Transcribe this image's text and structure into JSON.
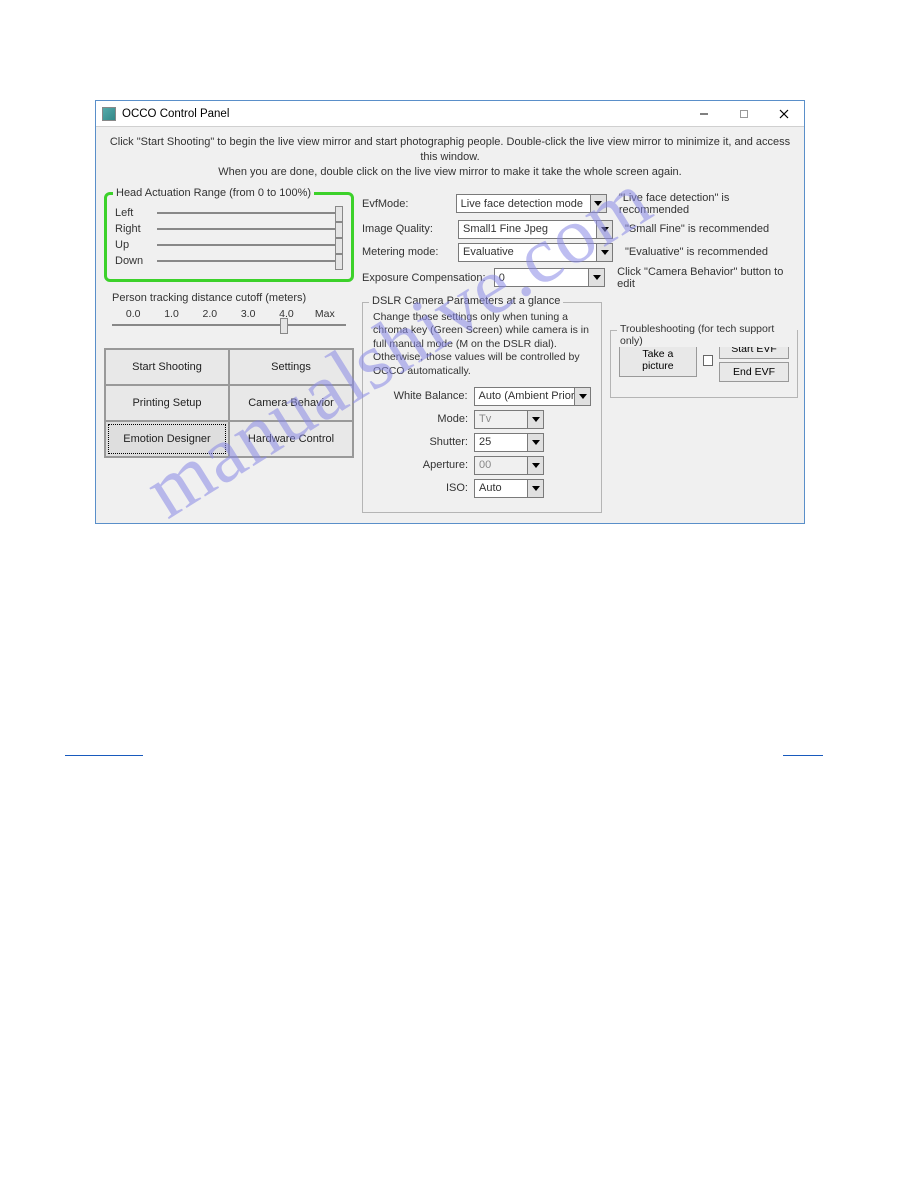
{
  "window": {
    "title": "OCCO Control Panel",
    "instructions_line1": "Click \"Start Shooting\" to begin the live view mirror and start photographig people. Double-click the live view mirror to minimize it, and access this window.",
    "instructions_line2": "When you are done, double click on the live view mirror to make it take the whole screen again."
  },
  "head_range": {
    "legend": "Head Actuation Range (from 0 to 100%)",
    "sliders": [
      "Left",
      "Right",
      "Up",
      "Down"
    ]
  },
  "distance_cutoff": {
    "legend": "Person tracking distance cutoff (meters)",
    "ticks": [
      "0.0",
      "1.0",
      "2.0",
      "3.0",
      "4.0",
      "Max"
    ]
  },
  "buttons": {
    "start_shooting": "Start Shooting",
    "settings": "Settings",
    "printing_setup": "Printing Setup",
    "camera_behavior": "Camera Behavior",
    "emotion_designer": "Emotion Designer",
    "hardware_control": "Hardware Control"
  },
  "params": {
    "evf_mode": {
      "label": "EvfMode:",
      "value": "Live face detection mode",
      "hint": "\"Live face detection\" is recommended"
    },
    "image_quality": {
      "label": "Image Quality:",
      "value": "Small1 Fine Jpeg",
      "hint": "\"Small Fine\" is recommended"
    },
    "metering_mode": {
      "label": "Metering mode:",
      "value": "Evaluative",
      "hint": "\"Evaluative\" is recommended"
    },
    "exposure_comp": {
      "label": "Exposure Compensation:",
      "value": "0",
      "hint": "Click \"Camera Behavior\" button to edit"
    }
  },
  "dslr": {
    "legend": "DSLR Camera Parameters at a glance",
    "note": "Change those settings only when tuning a chroma key (Green Screen) while camera is in full manual mode (M on the DSLR dial). Otherwise, those values will be controlled by OCCO automatically.",
    "white_balance": {
      "label": "White Balance:",
      "value": "Auto (Ambient Priority)"
    },
    "mode": {
      "label": "Mode:",
      "value": "Tv"
    },
    "shutter": {
      "label": "Shutter:",
      "value": "25"
    },
    "aperture": {
      "label": "Aperture:",
      "value": "00"
    },
    "iso": {
      "label": "ISO:",
      "value": "Auto"
    }
  },
  "trouble": {
    "legend": "Troubleshooting (for tech support only)",
    "take_picture": "Take a picture",
    "start_evf": "Start EVF",
    "end_evf": "End EVF"
  },
  "watermark": "manualshive.com"
}
